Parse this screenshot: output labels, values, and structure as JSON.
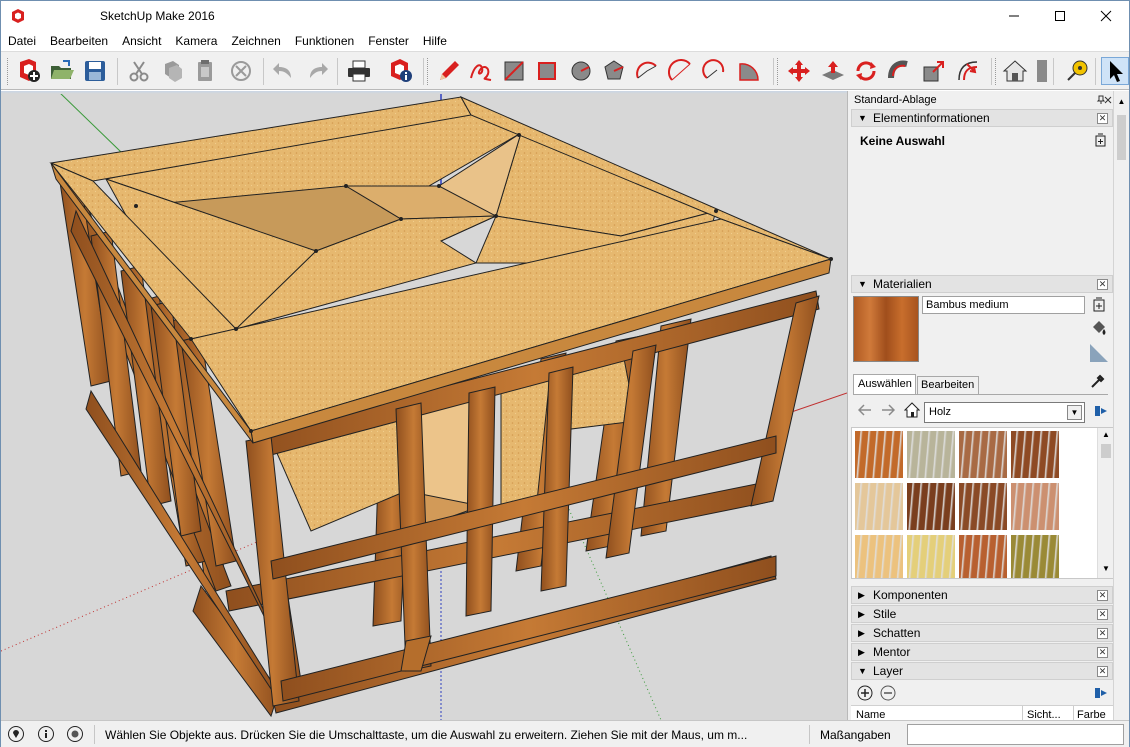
{
  "window": {
    "title": "SketchUp Make 2016",
    "controls": {
      "minimize": "—",
      "maximize": "☐",
      "close": "✕"
    }
  },
  "menu": [
    "Datei",
    "Bearbeiten",
    "Ansicht",
    "Kamera",
    "Zeichnen",
    "Funktionen",
    "Fenster",
    "Hilfe"
  ],
  "toolbar_icons": [
    "new-file-icon",
    "open-folder-icon",
    "save-icon",
    "cut-icon",
    "copy-icon",
    "paste-icon",
    "erase-icon",
    "undo-icon",
    "redo-icon",
    "print-icon",
    "model-info-icon",
    "pencil-icon",
    "freehand-icon",
    "rectangle-icon",
    "rotated-rectangle-icon",
    "circle-icon",
    "polygon-icon",
    "arc-icon",
    "two-point-arc-icon",
    "three-point-arc-icon",
    "pie-icon",
    "move-icon",
    "push-pull-icon",
    "rotate-icon",
    "follow-me-icon",
    "scale-icon",
    "offset-icon",
    "house-icon",
    "tape-measure-icon",
    "select-arrow-icon"
  ],
  "tray": {
    "title": "Standard-Ablage",
    "entity_info": {
      "header": "Elementinformationen",
      "selection": "Keine Auswahl"
    },
    "materials": {
      "header": "Materialien",
      "current_material": "Bambus medium",
      "tabs": [
        "Auswählen",
        "Bearbeiten"
      ],
      "library": "Holz",
      "swatch_colors": [
        "#c26a2a",
        "#b8b49a",
        "#a86a44",
        "#8e4a24",
        "#e4c79a",
        "#7a3e1e",
        "#8a4a26",
        "#cc9070",
        "#ecc27e",
        "#e4cf7a",
        "#b86030",
        "#9a8a36"
      ]
    },
    "panels": [
      {
        "label": "Komponenten",
        "expanded": false
      },
      {
        "label": "Stile",
        "expanded": false
      },
      {
        "label": "Schatten",
        "expanded": false
      },
      {
        "label": "Mentor",
        "expanded": false
      },
      {
        "label": "Layer",
        "expanded": true
      }
    ],
    "layer_columns": [
      "Name",
      "Sicht...",
      "Farbe"
    ]
  },
  "status": {
    "message": "Wählen Sie Objekte aus. Drücken Sie die Umschalttaste, um die Auswahl zu erweitern. Ziehen Sie mit der Maus, um m...",
    "measure_label": "Maßangaben",
    "measure_value": ""
  },
  "colors": {
    "accent_red": "#d9201f",
    "wood_frame": "#b5702e",
    "plywood": "#e3b56e",
    "sky_bg": "#d7d7d7"
  }
}
